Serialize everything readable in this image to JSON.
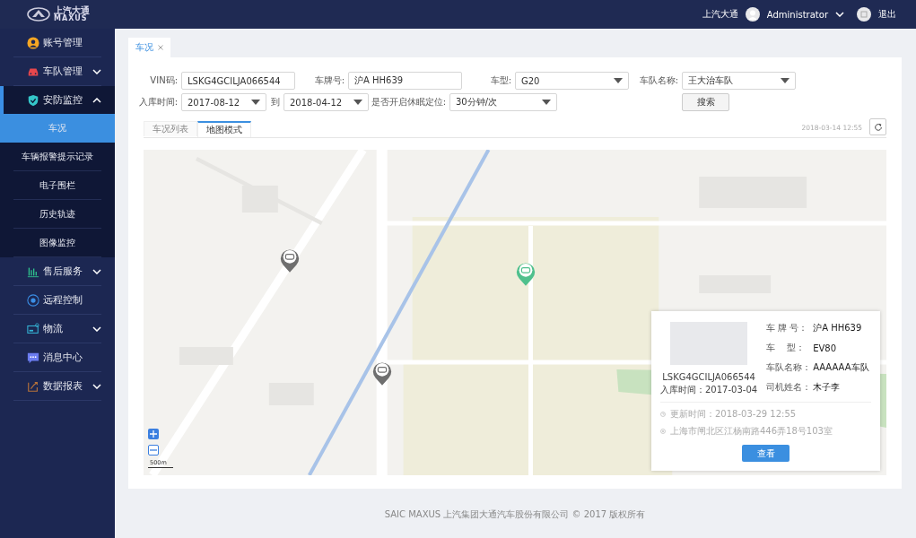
{
  "header": {
    "logo_text": "上汽大通",
    "logo_subtext": "MAXUS",
    "company": "上汽大通",
    "user": "Administrator",
    "logout": "退出"
  },
  "sidebar": {
    "items": [
      {
        "label": "账号管理",
        "kind": "link"
      },
      {
        "label": "车队管理",
        "kind": "group",
        "expanded": false
      },
      {
        "label": "安防监控",
        "kind": "group",
        "expanded": true,
        "children": [
          {
            "label": "车况",
            "selected": true
          },
          {
            "label": "车辆报警提示记录",
            "selected": false
          },
          {
            "label": "电子围栏",
            "selected": false
          },
          {
            "label": "历史轨迹",
            "selected": false
          },
          {
            "label": "图像监控",
            "selected": false
          }
        ]
      },
      {
        "label": "售后服务",
        "kind": "group",
        "expanded": false
      },
      {
        "label": "远程控制",
        "kind": "link"
      },
      {
        "label": "物流",
        "kind": "group",
        "expanded": false
      },
      {
        "label": "消息中心",
        "kind": "link"
      },
      {
        "label": "数据报表",
        "kind": "group",
        "expanded": false
      }
    ]
  },
  "page_tabs": [
    {
      "label": "车况",
      "selected": true
    }
  ],
  "filters": {
    "row_1": [
      {
        "label": "VIN码:",
        "kind": "input",
        "value": "LSKG4GCILJA066544"
      },
      {
        "label": "车牌号:",
        "kind": "input",
        "value": "沪A HH639"
      },
      {
        "label": "车型:",
        "kind": "select",
        "value": "G20"
      },
      {
        "label": "车队名称:",
        "kind": "select",
        "value": "王大治车队"
      }
    ],
    "date_label": "入库时间:",
    "date_from": "2017-08-12",
    "date_separator": "到",
    "date_to": "2018-04-12",
    "sleep_label": "是否开启休眠定位:",
    "sleep_value": "30分钟/次",
    "search_button": "搜索"
  },
  "view_tabs": [
    {
      "label": "车况列表",
      "selected": false
    },
    {
      "label": "地图模式",
      "selected": true
    }
  ],
  "timestamp": "2018-03-14  12:55",
  "map": {
    "markers": [
      {
        "color": "#6f6f6f"
      },
      {
        "color": "#6f6f6f"
      },
      {
        "color": "#4fc08d"
      }
    ],
    "scale": "500m",
    "info_card": {
      "vin": "LSKG4GCILJA066544",
      "stock_date": "入库时间：2017-03-04",
      "fields": [
        {
          "label": "车 牌 号：",
          "value": "沪A HH639"
        },
        {
          "label": "车    型：",
          "value": "EV80"
        },
        {
          "label": "车队名称：",
          "value": "AAAAAA车队"
        },
        {
          "label": "司机姓名：",
          "value": "木子李"
        }
      ],
      "updated": "更新时间：2018-03-29  12:55",
      "address": "上海市闸北区江杨南路446弄18号103室",
      "button": "查看"
    }
  },
  "footer": "SAIC MAXUS 上汽集团大通汽车股份有限公司 © 2017 版权所有"
}
